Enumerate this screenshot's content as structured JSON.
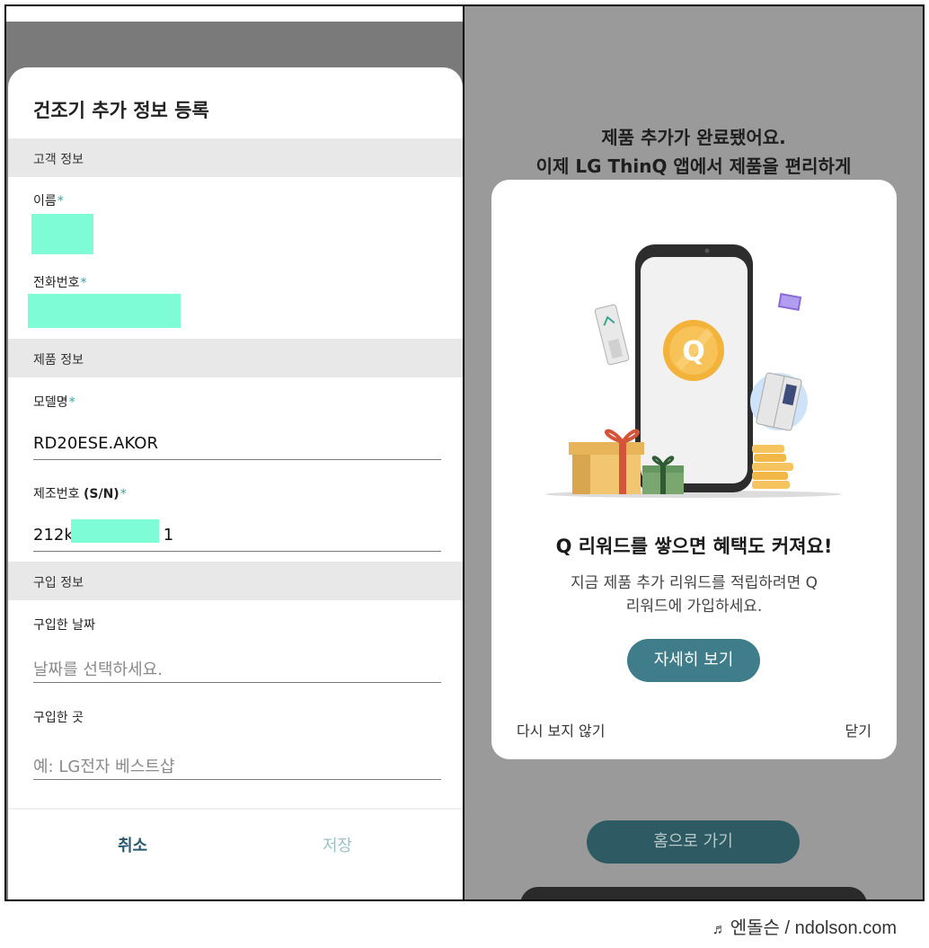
{
  "left": {
    "title": "건조기 추가 정보 등록",
    "sections": {
      "customer": "고객 정보",
      "product": "제품 정보",
      "purchase": "구입 정보"
    },
    "fields": {
      "name_label": "이름",
      "phone_label": "전화번호",
      "model_label": "모델명",
      "model_value": "RD20ESE.AKOR",
      "serial_label_prefix": "제조번호 ",
      "serial_label_strong": "(S/N)",
      "serial_value_start": "212k",
      "serial_value_end": "1",
      "purchase_date_label": "구입한 날짜",
      "purchase_date_placeholder": "날짜를 선택하세요.",
      "purchase_place_label": "구입한 곳",
      "purchase_place_placeholder": "예: LG전자 베스트샵"
    },
    "required_mark": "*",
    "buttons": {
      "cancel": "취소",
      "save": "저장"
    }
  },
  "right": {
    "bg_line1": "제품 추가가 완료됐어요.",
    "bg_line2": "이제 LG ThinQ 앱에서 제품을 편리하게",
    "home_button": "홈으로 가기",
    "modal": {
      "coin_letter": "Q",
      "heading": "Q 리워드를 쌓으면 혜택도 커져요!",
      "body_line1": "지금 제품 추가 리워드를 적립하려면 Q",
      "body_line2": "리워드에 가입하세요.",
      "detail_button": "자세히 보기",
      "dont_show": "다시 보지 않기",
      "close": "닫기"
    }
  },
  "watermark": {
    "icon": "music-note-icon",
    "text": "엔돌슨 / ndolson.com"
  },
  "colors": {
    "mask": "#7dfcd6",
    "accent_teal": "#3f7d8a",
    "required": "#2fa6a0",
    "cancel_text": "#2a5a6e",
    "save_text_disabled": "#9cc2c8"
  }
}
